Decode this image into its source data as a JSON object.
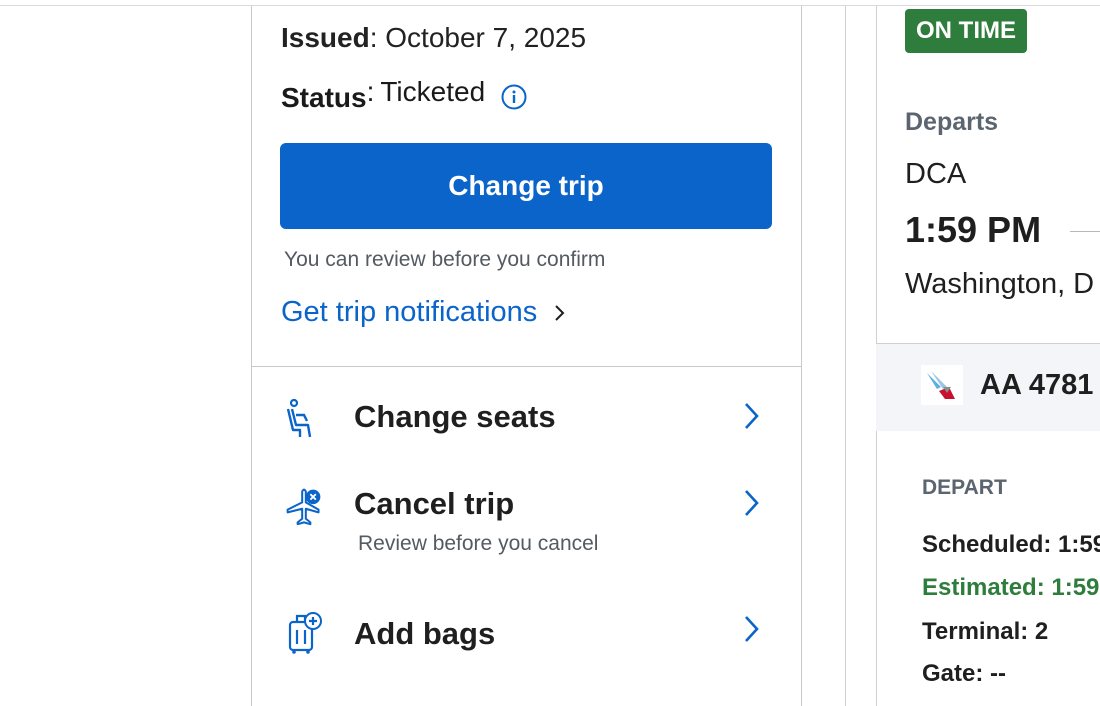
{
  "trip": {
    "issued_label": "Issued",
    "issued_value": "October 7, 2025",
    "status_label": "Status",
    "status_value": "Ticketed",
    "change_trip_label": "Change trip",
    "review_note": "You can review before you confirm",
    "notifications_link": "Get trip notifications"
  },
  "actions": [
    {
      "label": "Change seats",
      "icon": "seat-icon"
    },
    {
      "label": "Cancel trip",
      "sublabel": "Review before you cancel",
      "icon": "plane-cancel-icon"
    },
    {
      "label": "Add bags",
      "icon": "bag-add-icon"
    }
  ],
  "flight": {
    "status_badge": "ON TIME",
    "departs_label": "Departs",
    "dep_code": "DCA",
    "dep_time": "1:59 PM",
    "dep_city": "Washington, D",
    "flight_number": "AA 4781",
    "depart_header": "DEPART",
    "scheduled": "Scheduled: 1:59",
    "estimated": "Estimated: 1:59",
    "terminal": "Terminal: 2",
    "gate": "Gate: --"
  },
  "colors": {
    "primary": "#0a64c9",
    "on_time_green": "#2f7d3c",
    "muted_text": "#545a61"
  }
}
